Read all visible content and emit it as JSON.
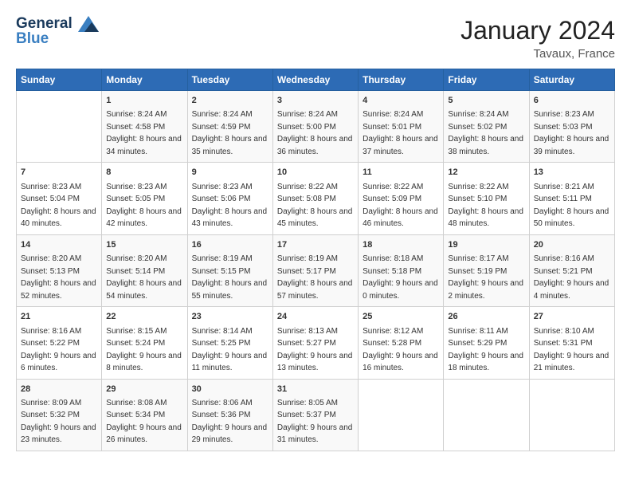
{
  "logo": {
    "line1": "General",
    "line2": "Blue"
  },
  "title": "January 2024",
  "subtitle": "Tavaux, France",
  "weekdays": [
    "Sunday",
    "Monday",
    "Tuesday",
    "Wednesday",
    "Thursday",
    "Friday",
    "Saturday"
  ],
  "weeks": [
    [
      {
        "day": "",
        "sunrise": "",
        "sunset": "",
        "daylight": ""
      },
      {
        "day": "1",
        "sunrise": "Sunrise: 8:24 AM",
        "sunset": "Sunset: 4:58 PM",
        "daylight": "Daylight: 8 hours and 34 minutes."
      },
      {
        "day": "2",
        "sunrise": "Sunrise: 8:24 AM",
        "sunset": "Sunset: 4:59 PM",
        "daylight": "Daylight: 8 hours and 35 minutes."
      },
      {
        "day": "3",
        "sunrise": "Sunrise: 8:24 AM",
        "sunset": "Sunset: 5:00 PM",
        "daylight": "Daylight: 8 hours and 36 minutes."
      },
      {
        "day": "4",
        "sunrise": "Sunrise: 8:24 AM",
        "sunset": "Sunset: 5:01 PM",
        "daylight": "Daylight: 8 hours and 37 minutes."
      },
      {
        "day": "5",
        "sunrise": "Sunrise: 8:24 AM",
        "sunset": "Sunset: 5:02 PM",
        "daylight": "Daylight: 8 hours and 38 minutes."
      },
      {
        "day": "6",
        "sunrise": "Sunrise: 8:23 AM",
        "sunset": "Sunset: 5:03 PM",
        "daylight": "Daylight: 8 hours and 39 minutes."
      }
    ],
    [
      {
        "day": "7",
        "sunrise": "Sunrise: 8:23 AM",
        "sunset": "Sunset: 5:04 PM",
        "daylight": "Daylight: 8 hours and 40 minutes."
      },
      {
        "day": "8",
        "sunrise": "Sunrise: 8:23 AM",
        "sunset": "Sunset: 5:05 PM",
        "daylight": "Daylight: 8 hours and 42 minutes."
      },
      {
        "day": "9",
        "sunrise": "Sunrise: 8:23 AM",
        "sunset": "Sunset: 5:06 PM",
        "daylight": "Daylight: 8 hours and 43 minutes."
      },
      {
        "day": "10",
        "sunrise": "Sunrise: 8:22 AM",
        "sunset": "Sunset: 5:08 PM",
        "daylight": "Daylight: 8 hours and 45 minutes."
      },
      {
        "day": "11",
        "sunrise": "Sunrise: 8:22 AM",
        "sunset": "Sunset: 5:09 PM",
        "daylight": "Daylight: 8 hours and 46 minutes."
      },
      {
        "day": "12",
        "sunrise": "Sunrise: 8:22 AM",
        "sunset": "Sunset: 5:10 PM",
        "daylight": "Daylight: 8 hours and 48 minutes."
      },
      {
        "day": "13",
        "sunrise": "Sunrise: 8:21 AM",
        "sunset": "Sunset: 5:11 PM",
        "daylight": "Daylight: 8 hours and 50 minutes."
      }
    ],
    [
      {
        "day": "14",
        "sunrise": "Sunrise: 8:20 AM",
        "sunset": "Sunset: 5:13 PM",
        "daylight": "Daylight: 8 hours and 52 minutes."
      },
      {
        "day": "15",
        "sunrise": "Sunrise: 8:20 AM",
        "sunset": "Sunset: 5:14 PM",
        "daylight": "Daylight: 8 hours and 54 minutes."
      },
      {
        "day": "16",
        "sunrise": "Sunrise: 8:19 AM",
        "sunset": "Sunset: 5:15 PM",
        "daylight": "Daylight: 8 hours and 55 minutes."
      },
      {
        "day": "17",
        "sunrise": "Sunrise: 8:19 AM",
        "sunset": "Sunset: 5:17 PM",
        "daylight": "Daylight: 8 hours and 57 minutes."
      },
      {
        "day": "18",
        "sunrise": "Sunrise: 8:18 AM",
        "sunset": "Sunset: 5:18 PM",
        "daylight": "Daylight: 9 hours and 0 minutes."
      },
      {
        "day": "19",
        "sunrise": "Sunrise: 8:17 AM",
        "sunset": "Sunset: 5:19 PM",
        "daylight": "Daylight: 9 hours and 2 minutes."
      },
      {
        "day": "20",
        "sunrise": "Sunrise: 8:16 AM",
        "sunset": "Sunset: 5:21 PM",
        "daylight": "Daylight: 9 hours and 4 minutes."
      }
    ],
    [
      {
        "day": "21",
        "sunrise": "Sunrise: 8:16 AM",
        "sunset": "Sunset: 5:22 PM",
        "daylight": "Daylight: 9 hours and 6 minutes."
      },
      {
        "day": "22",
        "sunrise": "Sunrise: 8:15 AM",
        "sunset": "Sunset: 5:24 PM",
        "daylight": "Daylight: 9 hours and 8 minutes."
      },
      {
        "day": "23",
        "sunrise": "Sunrise: 8:14 AM",
        "sunset": "Sunset: 5:25 PM",
        "daylight": "Daylight: 9 hours and 11 minutes."
      },
      {
        "day": "24",
        "sunrise": "Sunrise: 8:13 AM",
        "sunset": "Sunset: 5:27 PM",
        "daylight": "Daylight: 9 hours and 13 minutes."
      },
      {
        "day": "25",
        "sunrise": "Sunrise: 8:12 AM",
        "sunset": "Sunset: 5:28 PM",
        "daylight": "Daylight: 9 hours and 16 minutes."
      },
      {
        "day": "26",
        "sunrise": "Sunrise: 8:11 AM",
        "sunset": "Sunset: 5:29 PM",
        "daylight": "Daylight: 9 hours and 18 minutes."
      },
      {
        "day": "27",
        "sunrise": "Sunrise: 8:10 AM",
        "sunset": "Sunset: 5:31 PM",
        "daylight": "Daylight: 9 hours and 21 minutes."
      }
    ],
    [
      {
        "day": "28",
        "sunrise": "Sunrise: 8:09 AM",
        "sunset": "Sunset: 5:32 PM",
        "daylight": "Daylight: 9 hours and 23 minutes."
      },
      {
        "day": "29",
        "sunrise": "Sunrise: 8:08 AM",
        "sunset": "Sunset: 5:34 PM",
        "daylight": "Daylight: 9 hours and 26 minutes."
      },
      {
        "day": "30",
        "sunrise": "Sunrise: 8:06 AM",
        "sunset": "Sunset: 5:36 PM",
        "daylight": "Daylight: 9 hours and 29 minutes."
      },
      {
        "day": "31",
        "sunrise": "Sunrise: 8:05 AM",
        "sunset": "Sunset: 5:37 PM",
        "daylight": "Daylight: 9 hours and 31 minutes."
      },
      {
        "day": "",
        "sunrise": "",
        "sunset": "",
        "daylight": ""
      },
      {
        "day": "",
        "sunrise": "",
        "sunset": "",
        "daylight": ""
      },
      {
        "day": "",
        "sunrise": "",
        "sunset": "",
        "daylight": ""
      }
    ]
  ]
}
